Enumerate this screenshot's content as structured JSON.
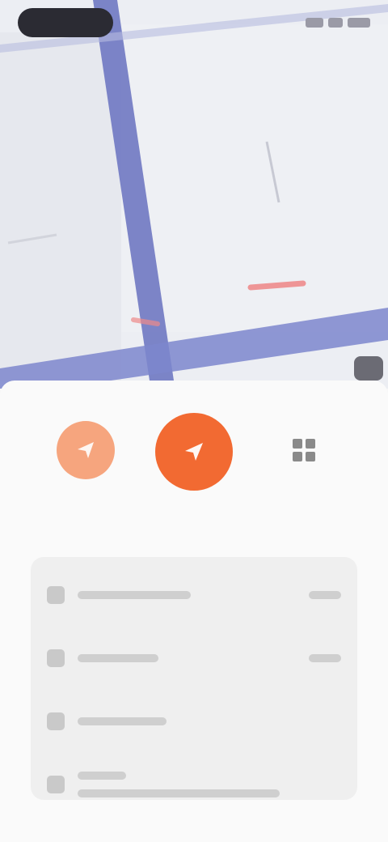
{
  "status_bar": {
    "pill_text": "",
    "right_indicators": [
      "signal-icon",
      "wifi-icon",
      "battery-icon"
    ]
  },
  "map": {
    "road_color": "#6f78c2",
    "background_color": "#eceef3",
    "marker_color": "#f08080"
  },
  "actions": [
    {
      "name": "left-action",
      "label": "",
      "icon": "send-icon",
      "color": "#f6a57e"
    },
    {
      "name": "center-action",
      "label": "",
      "icon": "navigate-icon",
      "color": "#f26a32"
    },
    {
      "name": "right-action",
      "label": "",
      "icon": "grid-icon",
      "color": "#8a8a8a"
    }
  ],
  "list": {
    "items": [
      {
        "icon": "location-icon",
        "title": "",
        "value": ""
      },
      {
        "icon": "route-icon",
        "title": "",
        "value": ""
      },
      {
        "icon": "info-icon",
        "title": "",
        "value": ""
      },
      {
        "icon": "share-icon",
        "title": "",
        "subtitle": "",
        "value": ""
      }
    ]
  }
}
